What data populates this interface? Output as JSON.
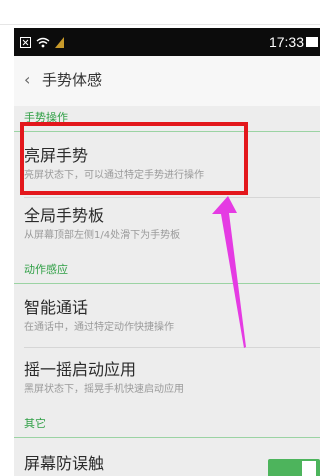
{
  "status_bar": {
    "time": "17:33"
  },
  "header": {
    "back_icon": "‹",
    "title": "手势体感"
  },
  "sections": [
    {
      "label": "手势操作",
      "items": [
        {
          "title": "亮屏手势",
          "subtitle": "亮屏状态下，可以通过特定手势进行操作"
        },
        {
          "title": "全局手势板",
          "subtitle": "从屏幕顶部左侧1/4处滑下为手势板"
        }
      ]
    },
    {
      "label": "动作感应",
      "items": [
        {
          "title": "智能通话",
          "subtitle": "在通话中，通过特定动作快捷操作"
        },
        {
          "title": "摇一摇启动应用",
          "subtitle": "黑屏状态下，摇晃手机快速启动应用"
        }
      ]
    },
    {
      "label": "其它",
      "items": [
        {
          "title": "屏幕防误触",
          "subtitle": ""
        }
      ]
    }
  ],
  "annotation": {
    "highlight_color": "#e3171c",
    "arrow_color": "#e53be3"
  },
  "colors": {
    "section_label": "#2f9f45",
    "toggle_on": "#4db45c"
  },
  "toggle": {
    "screen_mistouch": "on"
  }
}
